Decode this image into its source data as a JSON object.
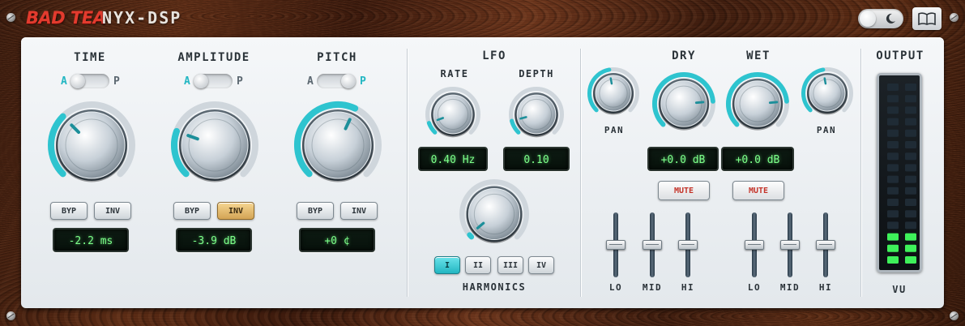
{
  "header": {
    "brand": "BAD TEA",
    "product": "NYX-DSP"
  },
  "toolbar": {
    "theme_toggle_icon": "moon-icon",
    "manual_icon": "book-icon"
  },
  "sections": {
    "time": {
      "title": "TIME",
      "mode_a": "A",
      "mode_p": "P",
      "mode": "A",
      "bypass_label": "BYP",
      "invert_label": "INV",
      "invert_active": false,
      "readout": "-2.2 ms"
    },
    "amplitude": {
      "title": "AMPLITUDE",
      "mode_a": "A",
      "mode_p": "P",
      "mode": "A",
      "bypass_label": "BYP",
      "invert_label": "INV",
      "invert_active": true,
      "readout": "-3.9 dB"
    },
    "pitch": {
      "title": "PITCH",
      "mode_a": "A",
      "mode_p": "P",
      "mode": "P",
      "bypass_label": "BYP",
      "invert_label": "INV",
      "invert_active": false,
      "readout": "+0 ¢"
    }
  },
  "lfo": {
    "title": "LFO",
    "rate_label": "RATE",
    "rate_readout": "0.40 Hz",
    "depth_label": "DEPTH",
    "depth_readout": "0.10",
    "harmonics_label": "HARMONICS",
    "harmonics": [
      "I",
      "II",
      "III",
      "IV"
    ],
    "harmonics_selected": "I"
  },
  "mix": {
    "dry_label": "DRY",
    "wet_label": "WET",
    "pan_label": "PAN",
    "dry_readout": "+0.0 dB",
    "wet_readout": "+0.0 dB",
    "mute_label": "MUTE",
    "eq_lo": "LO",
    "eq_mid": "MID",
    "eq_hi": "HI"
  },
  "output": {
    "title": "OUTPUT",
    "meter_label": "VU",
    "meter_lit_segments": 3,
    "meter_total_segments": 16
  },
  "colors": {
    "accent": "#2ec4cf",
    "brand": "#e23b2e",
    "lcd_text": "#7dff8a",
    "amber": "#e0b563"
  }
}
